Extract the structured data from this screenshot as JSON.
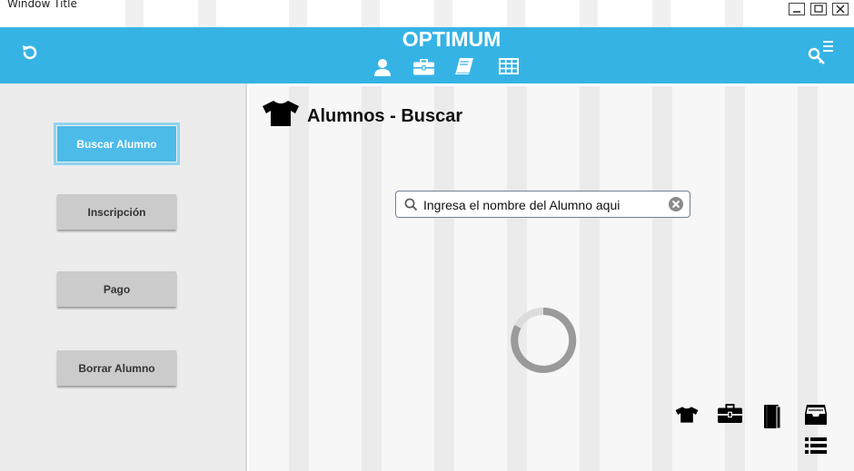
{
  "window": {
    "title": "Window Title",
    "controls": [
      "minimize-button",
      "maximize-button",
      "close-button"
    ]
  },
  "header": {
    "app_title": "OPTIMUM",
    "left_icon": "refresh-icon",
    "nav_icons": [
      "user-icon",
      "briefcase-icon",
      "book-icon",
      "table-icon"
    ],
    "right_icon": "key-menu-icon",
    "color": "#36b3e5"
  },
  "sidebar": {
    "buttons": [
      {
        "label": "Buscar Alumno",
        "active": true
      },
      {
        "label": "Inscripción",
        "active": false
      },
      {
        "label": "Pago",
        "active": false
      },
      {
        "label": "Borrar Alumno",
        "active": false
      }
    ]
  },
  "main": {
    "heading_icon": "tshirt-icon",
    "heading": "Alumnos - Buscar",
    "search": {
      "value": "Ingresa el nombre del Alumno aqui",
      "icon": "search-icon",
      "clear_icon": "clear-icon"
    },
    "loading_icon": "spinner-icon",
    "bottom_icons": [
      "tshirt-icon",
      "briefcase-icon",
      "book-icon",
      "inbox-icon",
      "list-icon"
    ]
  },
  "colors": {
    "accent": "#36b3e5",
    "active_button": "#4dbbe8",
    "button": "#cbcbcb",
    "sidebar": "#ececec"
  }
}
